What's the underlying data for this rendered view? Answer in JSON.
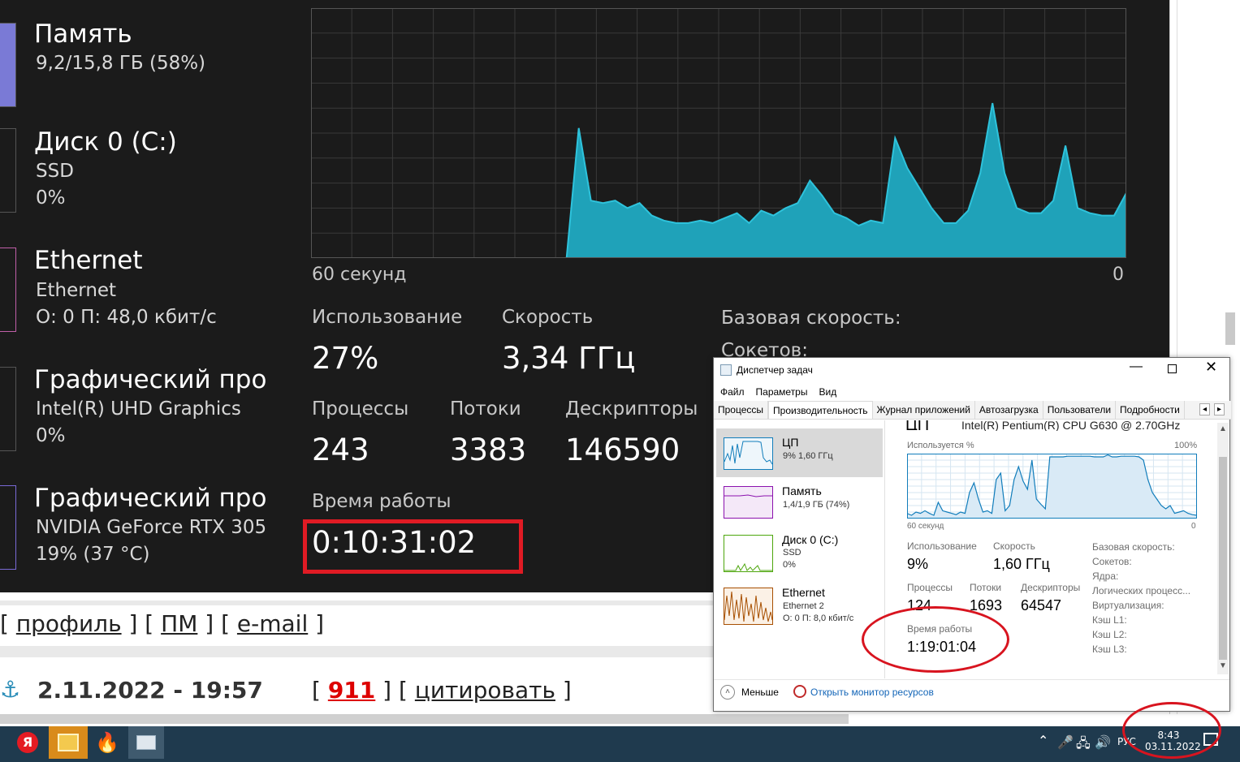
{
  "dark_tm": {
    "sidebar": [
      {
        "name": "Память",
        "sub1": "9,2/15,8 ГБ (58%)",
        "sub2": ""
      },
      {
        "name": "Диск 0 (C:)",
        "sub1": "SSD",
        "sub2": "0%"
      },
      {
        "name": "Ethernet",
        "sub1": "Ethernet",
        "sub2": "О: 0 П: 48,0 кбит/с"
      },
      {
        "name": "Графический про",
        "sub1": "Intel(R) UHD Graphics",
        "sub2": "0%"
      },
      {
        "name": "Графический про",
        "sub1": "NVIDIA GeForce RTX 305",
        "sub2": "19% (37 °C)"
      }
    ],
    "graph_left_label": "60 секунд",
    "graph_right_label": "0",
    "usage_label": "Использование",
    "usage_value": "27%",
    "speed_label": "Скорость",
    "speed_value": "3,34 ГГц",
    "base_speed_label": "Базовая скорость:",
    "sockets_label": "Сокетов:",
    "processes_label": "Процессы",
    "processes_value": "243",
    "threads_label": "Потоки",
    "threads_value": "3383",
    "handles_label": "Дескрипторы",
    "handles_value": "146590",
    "uptime_label": "Время работы",
    "uptime_value": "0:10:31:02",
    "chart_points": [
      0,
      0,
      0,
      0,
      0,
      0,
      0,
      0,
      0,
      0,
      0,
      0,
      0,
      0,
      0,
      0,
      0,
      0,
      0,
      0,
      0,
      0,
      52,
      23,
      22,
      23,
      20,
      22,
      17,
      15,
      14,
      14,
      15,
      14,
      16,
      18,
      14,
      19,
      17,
      20,
      22,
      31,
      25,
      18,
      16,
      13,
      15,
      14,
      48,
      36,
      28,
      20,
      14,
      14,
      19,
      34,
      62,
      34,
      20,
      18,
      18,
      23,
      45,
      20,
      18,
      17,
      17,
      26
    ]
  },
  "forum": {
    "links": [
      "профиль",
      "ПМ",
      "e-mail"
    ],
    "date": "2.11.2022 - 19:57",
    "post_no": "911",
    "quote": "цитировать"
  },
  "win": {
    "title": "Диспетчер задач",
    "menu": [
      "Файл",
      "Параметры",
      "Вид"
    ],
    "tabs": [
      "Процессы",
      "Производительность",
      "Журнал приложений",
      "Автозагрузка",
      "Пользователи",
      "Подробности"
    ],
    "resources": [
      {
        "name": "ЦП",
        "sub1": "9% 1,60 ГГц",
        "sub2": "",
        "color": "#117dbb"
      },
      {
        "name": "Память",
        "sub1": "1,4/1,9 ГБ (74%)",
        "sub2": "",
        "color": "#8b12ae"
      },
      {
        "name": "Диск 0 (C:)",
        "sub1": "SSD",
        "sub2": "0%",
        "color": "#4da60c"
      },
      {
        "name": "Ethernet",
        "sub1": "Ethernet 2",
        "sub2": "О: 0 П: 8,0 кбит/с",
        "color": "#a74f01"
      }
    ],
    "cpu_title": "ЦП",
    "cpu_model": "Intel(R) Pentium(R) CPU G630 @ 2.70GHz",
    "used_label": "Используется %",
    "max_label": "100%",
    "seconds_label": "60 секунд",
    "zero_label": "0",
    "usage_label": "Использование",
    "usage_value": "9%",
    "speed_label": "Скорость",
    "speed_value": "1,60 ГГц",
    "processes_label": "Процессы",
    "processes_value": "124",
    "threads_label": "Потоки",
    "threads_value": "1693",
    "handles_label": "Дескрипторы",
    "handles_value": "64547",
    "uptime_label": "Время работы",
    "uptime_value": "1:19:01:04",
    "right_labels": [
      "Базовая скорость:",
      "Сокетов:",
      "Ядра:",
      "Логических процесс...",
      "Виртуализация:",
      "Кэш L1:",
      "Кэш L2:",
      "Кэш L3:"
    ],
    "less_label": "Меньше",
    "monitor_label": "Открыть монитор ресурсов",
    "chart_points": [
      8,
      5,
      10,
      8,
      12,
      8,
      5,
      25,
      12,
      10,
      8,
      6,
      10,
      8,
      40,
      55,
      30,
      10,
      12,
      8,
      60,
      70,
      12,
      20,
      60,
      80,
      58,
      45,
      90,
      30,
      22,
      15,
      95,
      95,
      95,
      95,
      96,
      96,
      96,
      96,
      96,
      96,
      95,
      95,
      95,
      98,
      95,
      95,
      96,
      96,
      96,
      96,
      95,
      90,
      60,
      40,
      30,
      20,
      15,
      20,
      8,
      10,
      12,
      8,
      6,
      5
    ]
  },
  "taskbar": {
    "time": "8:43",
    "date": "03.11.2022",
    "lang": "РУС",
    "accent": "#1f3a4e"
  }
}
